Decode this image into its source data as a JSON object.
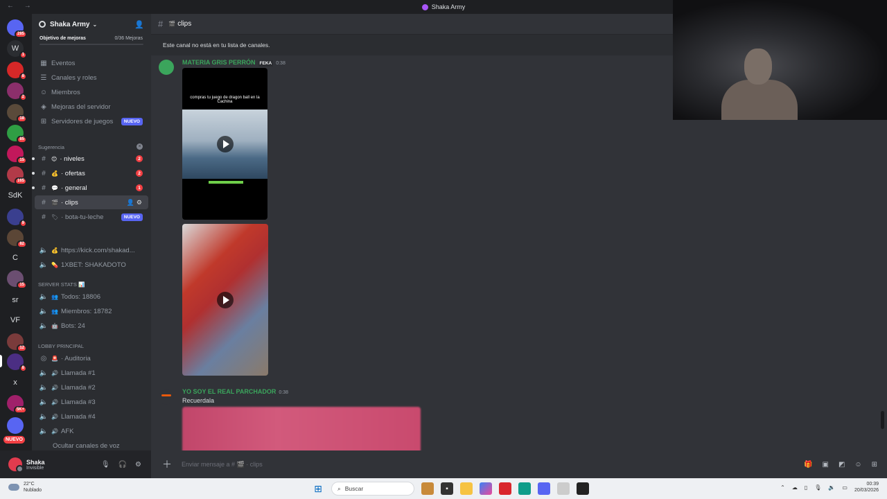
{
  "window": {
    "title": "Shaka Army",
    "nav": "← →"
  },
  "rail": {
    "servers": [
      {
        "label": "",
        "color": "#5865f2",
        "badge": "285"
      },
      {
        "label": "W",
        "color": "#2b2d31",
        "badge": "1"
      },
      {
        "label": "",
        "color": "#d62828",
        "badge": "8"
      },
      {
        "label": "",
        "color": "#8b2f6b",
        "badge": "2"
      },
      {
        "label": "",
        "color": "#5a4a3a",
        "badge": "18"
      },
      {
        "label": "",
        "color": "#2f9e44",
        "badge": "85"
      },
      {
        "label": "",
        "color": "#c2185b",
        "badge": "15"
      },
      {
        "label": "",
        "color": "#b23a48",
        "badge": "165"
      },
      {
        "label": "SdK",
        "color": "transparent",
        "badge": ""
      },
      {
        "label": "",
        "color": "#3a3f8f",
        "badge": "9"
      },
      {
        "label": "",
        "color": "#5b4636",
        "badge": "82"
      },
      {
        "label": "C",
        "color": "transparent",
        "badge": ""
      },
      {
        "label": "",
        "color": "#6b4e71",
        "badge": "15"
      },
      {
        "label": "sr",
        "color": "transparent",
        "badge": ""
      },
      {
        "label": "VF",
        "color": "transparent",
        "badge": ""
      },
      {
        "label": "",
        "color": "#7a3b3b",
        "badge": "12"
      },
      {
        "label": "",
        "color": "#4b2e83",
        "badge": "8"
      },
      {
        "label": "x",
        "color": "transparent",
        "badge": ""
      },
      {
        "label": "",
        "color": "#a0206a",
        "badge": "5K+"
      },
      {
        "label": "",
        "color": "#5865f2",
        "badge": ""
      }
    ],
    "new_label": "NUEVO"
  },
  "sidebar": {
    "server_name": "Shaka Army",
    "goal_label": "Objetivo de mejoras",
    "goal_progress": "0/36 Mejoras",
    "menu": [
      {
        "label": "Eventos",
        "icon": "calendar-icon",
        "glyph": "▦"
      },
      {
        "label": "Canales y roles",
        "icon": "list-icon",
        "glyph": "☰"
      },
      {
        "label": "Miembros",
        "icon": "members-icon",
        "glyph": "☺"
      },
      {
        "label": "Mejoras del servidor",
        "icon": "boost-icon",
        "glyph": "◈"
      },
      {
        "label": "Servidores de juegos",
        "icon": "gamepad-icon",
        "glyph": "⊞",
        "tag": "NUEVO"
      }
    ],
    "category_1": "Sugerencia",
    "channels": [
      {
        "label": "niveles",
        "emoji": "😊",
        "count": "2"
      },
      {
        "label": "ofertas",
        "emoji": "💰",
        "count": "2"
      },
      {
        "label": "general",
        "emoji": "💬",
        "count": "1"
      },
      {
        "label": "clips",
        "emoji": "🎬"
      },
      {
        "label": "bota-tu-leche",
        "emoji": "🏷",
        "tag": "NUEVO"
      }
    ],
    "links": [
      {
        "label": "https://kick.com/shakad...",
        "emoji": "💰"
      },
      {
        "label": "1XBET: SHAKADOTO",
        "emoji": "💊"
      }
    ],
    "stats_title": "SERVER STATS",
    "stats": [
      {
        "label": "Todos: 18806",
        "emoji": "👥"
      },
      {
        "label": "Miembros: 18782",
        "emoji": "👥"
      },
      {
        "label": "Bots: 24",
        "emoji": "🤖"
      }
    ],
    "lobby_title": "LOBBY PRINCIPAL",
    "voice": [
      {
        "label": "Auditoria",
        "emoji": "🚨"
      },
      {
        "label": "Llamada #1",
        "emoji": "🔊"
      },
      {
        "label": "Llamada #2",
        "emoji": "🔊"
      },
      {
        "label": "Llamada #3",
        "emoji": "🔊"
      },
      {
        "label": "Llamada #4",
        "emoji": "🔊"
      },
      {
        "label": "AFK",
        "emoji": "🔊"
      }
    ],
    "hidden_label": "Ocultar canales de voz"
  },
  "user": {
    "name": "Shaka",
    "status": "Invisible"
  },
  "chat": {
    "channel": "clips",
    "notice": "Este canal no está en tu lista de canales.",
    "messages": [
      {
        "author": "MATERIA GRIS PERRÓN",
        "tag": "FEKA",
        "time": "0:38",
        "video_caption": "compras tu juego de dragon ball en la Cachina"
      },
      {
        "author": "YO SOY EL REAL PARCHADOR",
        "time": "0:38",
        "text": "Recuerdala"
      }
    ],
    "composer_placeholder": "Enviar mensaje a #",
    "composer_channel": "clips"
  },
  "taskbar": {
    "temp": "22°C",
    "weather": "Nublado",
    "search": "Buscar",
    "time": "00:39",
    "date": "20/03/2026"
  }
}
